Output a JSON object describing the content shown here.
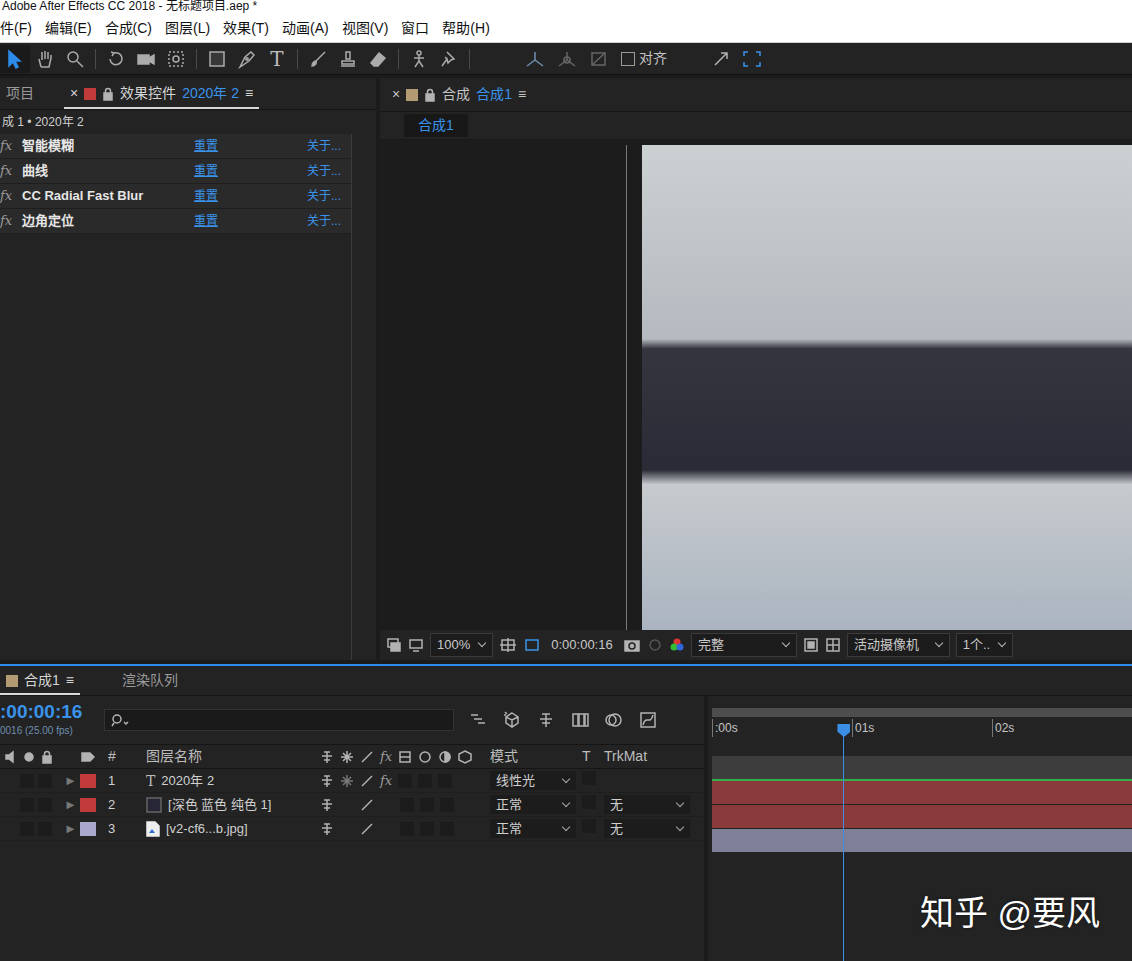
{
  "window": {
    "title": "Adobe After Effects CC 2018 - 无标题项目.aep *"
  },
  "menu": [
    "件(F)",
    "编辑(E)",
    "合成(C)",
    "图层(L)",
    "效果(T)",
    "动画(A)",
    "视图(V)",
    "窗口",
    "帮助(H)"
  ],
  "toolbar": {
    "tools": [
      {
        "kind": "select",
        "selected": true
      },
      {
        "kind": "hand",
        "selected": false
      },
      {
        "kind": "zoom",
        "selected": false
      },
      {
        "kind": "rotate",
        "selected": false
      },
      {
        "kind": "camera",
        "selected": false
      },
      {
        "kind": "pan",
        "selected": false
      },
      {
        "kind": "rect",
        "selected": false
      },
      {
        "kind": "pen",
        "selected": false
      },
      {
        "kind": "text",
        "selected": false,
        "glyph": "T"
      },
      {
        "kind": "brush",
        "selected": false
      },
      {
        "kind": "stamp",
        "selected": false
      },
      {
        "kind": "eraser",
        "selected": false
      },
      {
        "kind": "puppet",
        "selected": false
      },
      {
        "kind": "pin",
        "selected": false
      }
    ],
    "snap": {
      "label": "对齐",
      "checked": false
    }
  },
  "left_panel": {
    "tabs": [
      {
        "label": "项目",
        "selected": false
      },
      {
        "close": "×",
        "label": "效果控件",
        "layer": "2020年 2",
        "menu": "≡",
        "selected": true
      }
    ],
    "breadcrumb": "成 1 • 2020年 2",
    "effects": [
      {
        "fx": "fx",
        "name": "智能模糊",
        "reset": "重置",
        "about": "关于..."
      },
      {
        "fx": "fx",
        "name": "曲线",
        "reset": "重置",
        "about": "关于..."
      },
      {
        "fx": "fx",
        "name": "CC Radial Fast Blur",
        "reset": "重置",
        "about": "关于..."
      },
      {
        "fx": "fx",
        "name": "边角定位",
        "reset": "重置",
        "about": "关于..."
      }
    ]
  },
  "comp_panel": {
    "tab": {
      "close": "×",
      "label": "合成",
      "comp": "合成1",
      "menu": "≡",
      "selected": true
    },
    "sub_tab": "合成1",
    "viewer": {
      "zoom": "100%",
      "time": "0:00:00:16",
      "quality": "完整",
      "camera": "活动摄像机",
      "views": "1个.."
    }
  },
  "timeline": {
    "tabs": [
      {
        "label": "合成1",
        "menu": "≡",
        "selected": true
      },
      {
        "label": "渲染队列",
        "selected": false
      }
    ],
    "timecode": ":00:00:16",
    "frames": "0016 (25.00 fps)",
    "columns": {
      "num": "#",
      "name": "图层名称",
      "fx": "fx",
      "mode": "模式",
      "t": "T",
      "trkmat": "TrkMat"
    },
    "ruler": [
      ":00s",
      "01s",
      "02s"
    ],
    "playhead": {
      "level": 0.31
    },
    "layers": [
      {
        "expander": "►",
        "num": "1",
        "kind": "text",
        "glyph": "T",
        "name": "2020年 2",
        "fx": "fx",
        "mode": "线性光",
        "color": "#c23b3b",
        "bar_color": "#8a3a3a"
      },
      {
        "expander": "►",
        "num": "2",
        "kind": "solid",
        "name": "[深色 蓝色 纯色 1]",
        "mode": "正常",
        "trkmat": "无",
        "color": "#c23b3b",
        "bar_color": "#8a3a3a"
      },
      {
        "expander": "►",
        "num": "3",
        "kind": "image",
        "name": "[v2-cf6...b.jpg]",
        "mode": "正常",
        "trkmat": "无",
        "color": "#a9a9cc",
        "bar_color": "#7f8097"
      }
    ]
  },
  "watermark": "知乎 @要风"
}
